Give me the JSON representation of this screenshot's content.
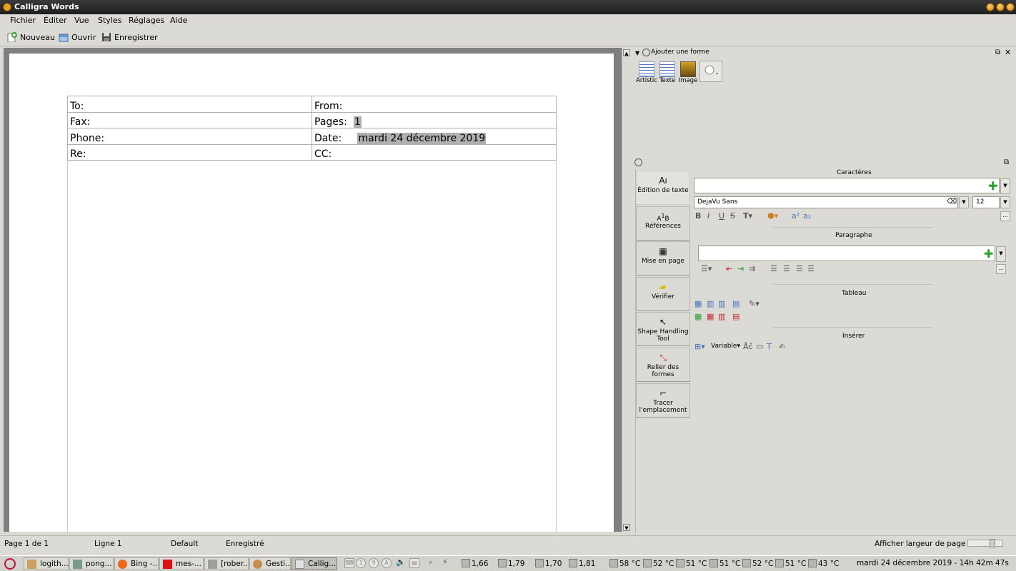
{
  "window": {
    "title": "Calligra Words"
  },
  "menu": [
    {
      "label": "Fichier"
    },
    {
      "label": "Éditer"
    },
    {
      "label": "Vue"
    },
    {
      "label": "Styles"
    },
    {
      "label": "Réglages"
    },
    {
      "label": "Aide"
    }
  ],
  "toolbar": {
    "new_label": "Nouveau",
    "open_label": "Ouvrir",
    "save_label": "Enregistrer"
  },
  "document": {
    "rows": [
      {
        "left": "To:",
        "right_label": "From:",
        "right_value": ""
      },
      {
        "left": "Fax:",
        "right_label": "Pages:",
        "right_value": "1"
      },
      {
        "left": "Phone:",
        "right_label": "Date:",
        "right_value": "mardi 24 décembre 2019"
      },
      {
        "left": "Re:",
        "right_label": "CC:",
        "right_value": ""
      }
    ]
  },
  "shapes_docker": {
    "title": "Ajouter une forme",
    "items": [
      {
        "label": "Artistic"
      },
      {
        "label": "Texte"
      },
      {
        "label": "Image"
      }
    ]
  },
  "tools": [
    {
      "label": "Édition de texte",
      "icon": "text-cursor-icon"
    },
    {
      "label": "Références",
      "icon": "references-icon"
    },
    {
      "label": "Mise en page",
      "icon": "layout-icon"
    },
    {
      "label": "Vérifier",
      "icon": "comment-icon"
    },
    {
      "label": "Shape Handling Tool",
      "icon": "pointer-icon"
    },
    {
      "label": "Relier des formes",
      "icon": "connector-icon"
    },
    {
      "label": "Tracer l'emplacement",
      "icon": "path-icon"
    }
  ],
  "tool_options": {
    "characters_title": "Caractères",
    "font_name": "DejaVu Sans",
    "font_size": "12",
    "paragraph_title": "Paragraphe",
    "table_title": "Tableau",
    "insert_title": "Insérer",
    "variable_label": "Variable"
  },
  "statusbar": {
    "page": "Page 1 de 1",
    "line": "Ligne 1",
    "style": "Default",
    "saved": "Enregistré",
    "zoom_label": "Afficher largeur de page"
  },
  "taskbar": {
    "tasks": [
      {
        "label": "logith..."
      },
      {
        "label": "pong..."
      },
      {
        "label": "Bing -..."
      },
      {
        "label": "mes-..."
      },
      {
        "label": "[rober..."
      },
      {
        "label": "Gesti..."
      },
      {
        "label": "Callig..."
      }
    ],
    "cpu": [
      "1,66",
      "1,79",
      "1,70",
      "1,81"
    ],
    "temps": [
      "58 °C",
      "52 °C",
      "51 °C",
      "51 °C",
      "52 °C",
      "51 °C",
      "43 °C"
    ],
    "clock": "mardi 24 décembre 2019 - 14h 42m 47s"
  },
  "colors": {
    "titlebar": "#2a2a2a",
    "panel": "#dcdad5",
    "highlight": "#b0b0b0",
    "accent_green": "#2ea02e"
  }
}
